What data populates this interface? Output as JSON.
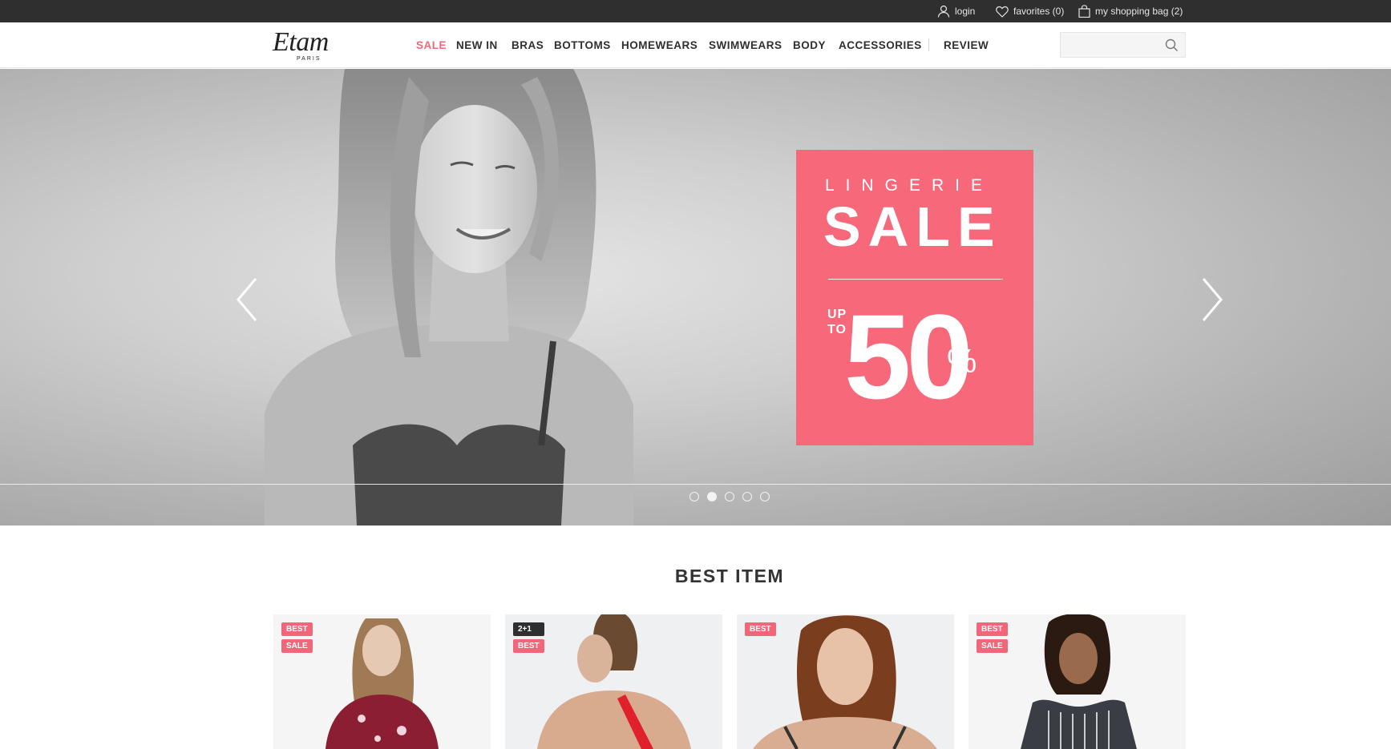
{
  "topbar": {
    "login": "login",
    "favorites": "favorites (0)",
    "bag": "my shopping bag (2)"
  },
  "header": {
    "logo_main": "Etam",
    "logo_sub": "PARIS",
    "nav": [
      "SALE",
      "NEW IN",
      "BRAS",
      "BOTTOMS",
      "HOMEWEARS",
      "SWIMWEARS",
      "BODY",
      "ACCESSORIES",
      "REVIEW"
    ],
    "search_value": ""
  },
  "hero": {
    "line1": "LINGERIE",
    "line2": "SALE",
    "up": "UP",
    "to": "TO",
    "amount": "50",
    "percent": "%",
    "slides": 5,
    "active_slide": 2
  },
  "best": {
    "title": "BEST ITEM",
    "items": [
      {
        "badges": [
          "BEST",
          "SALE"
        ]
      },
      {
        "badges": [
          "2+1",
          "BEST"
        ]
      },
      {
        "badges": [
          "BEST"
        ]
      },
      {
        "badges": [
          "BEST",
          "SALE"
        ]
      }
    ]
  },
  "colors": {
    "accent": "#f16679",
    "promo": "#f6687a",
    "topbar": "#2f2f2f"
  }
}
